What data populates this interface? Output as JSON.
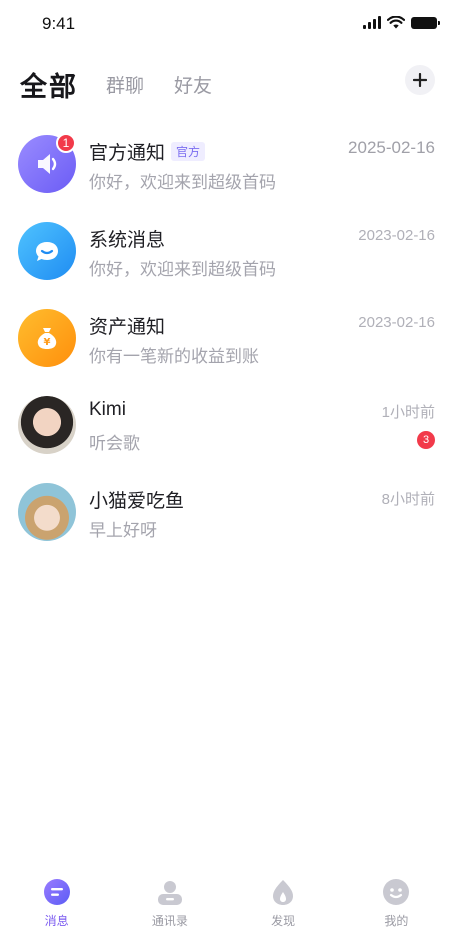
{
  "status_bar": {
    "time": "9:41"
  },
  "header": {
    "tabs": [
      {
        "label": "全部",
        "active": true
      },
      {
        "label": "群聊",
        "active": false
      },
      {
        "label": "好友",
        "active": false
      }
    ],
    "add_icon": "plus-icon"
  },
  "messages": [
    {
      "title": "官方通知",
      "tag": "官方",
      "preview": "你好，欢迎来到超级首码",
      "time": "2025-02-16",
      "unread": "1",
      "avatar_icon": "speaker-icon"
    },
    {
      "title": "系统消息",
      "preview": "你好，欢迎来到超级首码",
      "time": "2023-02-16",
      "avatar_icon": "chat-bubble-icon"
    },
    {
      "title": "资产通知",
      "preview": "你有一笔新的收益到账",
      "time": "2023-02-16",
      "avatar_icon": "money-bag-icon"
    },
    {
      "title": "Kimi",
      "preview": "听会歌",
      "time": "1小时前",
      "unread": "3",
      "avatar_icon": "user-photo"
    },
    {
      "title": "小猫爱吃鱼",
      "preview": "早上好呀",
      "time": "8小时前",
      "avatar_icon": "user-photo"
    }
  ],
  "bottom_nav": [
    {
      "label": "消息",
      "icon": "message-icon",
      "active": true
    },
    {
      "label": "通讯录",
      "icon": "contacts-icon",
      "active": false
    },
    {
      "label": "发现",
      "icon": "discover-icon",
      "active": false
    },
    {
      "label": "我的",
      "icon": "profile-icon",
      "active": false
    }
  ],
  "colors": {
    "accent": "#7c5cf0",
    "badge": "#f23a4a",
    "muted": "#a4a4ad"
  }
}
